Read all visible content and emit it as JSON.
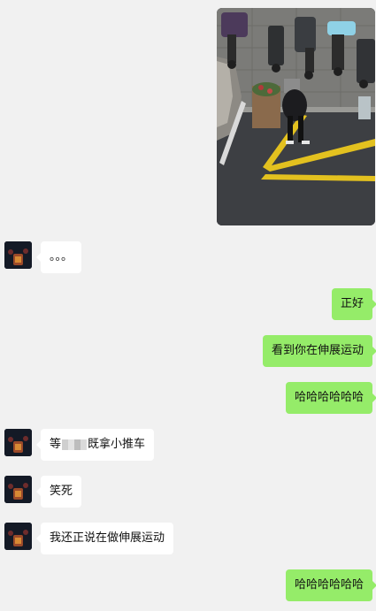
{
  "messages": [
    {
      "side": "out",
      "type": "image",
      "icon": "photo-image"
    },
    {
      "side": "in",
      "text": "。。。"
    },
    {
      "side": "out",
      "text": "正好"
    },
    {
      "side": "out",
      "text": "看到你在伸展运动"
    },
    {
      "side": "out",
      "text": "哈哈哈哈哈哈"
    },
    {
      "side": "in",
      "text_before": "等",
      "text_after": "既拿小推车"
    },
    {
      "side": "in",
      "text": "笑死"
    },
    {
      "side": "in",
      "text": "我还正说在做伸展运动"
    },
    {
      "side": "out",
      "text": "哈哈哈哈哈哈"
    }
  ],
  "colors": {
    "background": "#f1f1f1",
    "incoming_bubble": "#ffffff",
    "outgoing_bubble": "#95ec69"
  }
}
